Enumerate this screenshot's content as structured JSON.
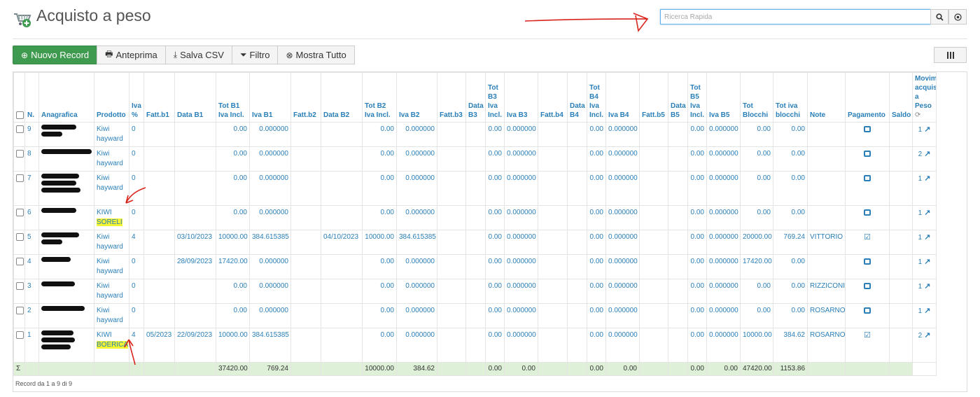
{
  "header": {
    "title": "Acquisto a peso",
    "search_placeholder": "Ricerca Rapida",
    "search_icon": "magnifier-icon",
    "clear_icon": "clear-circle-icon"
  },
  "toolbar": {
    "new_record": "Nuovo Record",
    "preview": "Anteprima",
    "save_csv": "Salva CSV",
    "filter": "Filtro",
    "show_all": "Mostra Tutto",
    "columns_icon": "columns-icon"
  },
  "columns": {
    "n": "N.",
    "anagrafica": "Anagrafica",
    "prodotto": "Prodotto",
    "iva": "Iva %",
    "fatt_b1": "Fatt.b1",
    "data_b1": "Data B1",
    "tot_b1": "Tot B1 Iva Incl.",
    "iva_b1": "Iva B1",
    "fatt_b2": "Fatt.b2",
    "data_b2": "Data B2",
    "tot_b2": "Tot B2 Iva Incl.",
    "iva_b2": "Iva B2",
    "fatt_b3": "Fatt.b3",
    "data_b3": "Data B3",
    "tot_b3": "Tot B3 Iva Incl.",
    "iva_b3": "Iva B3",
    "fatt_b4": "Fatt.b4",
    "data_b4": "Data B4",
    "tot_b4": "Tot B4 Iva Incl.",
    "iva_b4": "Iva B4",
    "fatt_b5": "Fatt.b5",
    "data_b5": "Data B5",
    "tot_b5": "Tot B5 Iva Incl.",
    "iva_b5": "Iva B5",
    "tot_blocchi": "Tot Blocchi",
    "tot_iva_blocchi": "Tot iva blocchi",
    "note": "Note",
    "pagamento": "Pagamento",
    "saldo": "Saldo",
    "movimenti": "Movimenti acquisto a Peso"
  },
  "rows": [
    {
      "n": "9",
      "prod1": "Kiwi",
      "prod2": "hayward",
      "iva": "0",
      "fatt_b1": "",
      "data_b1": "",
      "tot_b1": "0.00",
      "iva_b1": "0.000000",
      "fatt_b2": "",
      "data_b2": "",
      "tot_b2": "0.00",
      "iva_b2": "0.000000",
      "tot_b3": "0.00",
      "iva_b3": "0.000000",
      "tot_b4": "0.00",
      "iva_b4": "0.000000",
      "tot_b5": "0.00",
      "iva_b5": "0.000000",
      "tot_blocchi": "0.00",
      "tot_iva_blocchi": "0.00",
      "note": "",
      "paid": false,
      "mov": "1"
    },
    {
      "n": "8",
      "prod1": "Kiwi",
      "prod2": "hayward",
      "iva": "0",
      "fatt_b1": "",
      "data_b1": "",
      "tot_b1": "0.00",
      "iva_b1": "0.000000",
      "fatt_b2": "",
      "data_b2": "",
      "tot_b2": "0.00",
      "iva_b2": "0.000000",
      "tot_b3": "0.00",
      "iva_b3": "0.000000",
      "tot_b4": "0.00",
      "iva_b4": "0.000000",
      "tot_b5": "0.00",
      "iva_b5": "0.000000",
      "tot_blocchi": "0.00",
      "tot_iva_blocchi": "0.00",
      "note": "",
      "paid": false,
      "mov": "2"
    },
    {
      "n": "7",
      "prod1": "Kiwi",
      "prod2": "hayward",
      "iva": "0",
      "fatt_b1": "",
      "data_b1": "",
      "tot_b1": "0.00",
      "iva_b1": "0.000000",
      "fatt_b2": "",
      "data_b2": "",
      "tot_b2": "0.00",
      "iva_b2": "0.000000",
      "tot_b3": "0.00",
      "iva_b3": "0.000000",
      "tot_b4": "0.00",
      "iva_b4": "0.000000",
      "tot_b5": "0.00",
      "iva_b5": "0.000000",
      "tot_blocchi": "0.00",
      "tot_iva_blocchi": "0.00",
      "note": "",
      "paid": false,
      "mov": "1"
    },
    {
      "n": "6",
      "prod1": "KIWI",
      "prod2": "SORELI",
      "iva": "0",
      "fatt_b1": "",
      "data_b1": "",
      "tot_b1": "0.00",
      "iva_b1": "0.000000",
      "fatt_b2": "",
      "data_b2": "",
      "tot_b2": "0.00",
      "iva_b2": "0.000000",
      "tot_b3": "0.00",
      "iva_b3": "0.000000",
      "tot_b4": "0.00",
      "iva_b4": "0.000000",
      "tot_b5": "0.00",
      "iva_b5": "0.000000",
      "tot_blocchi": "0.00",
      "tot_iva_blocchi": "0.00",
      "note": "",
      "paid": false,
      "mov": "1"
    },
    {
      "n": "5",
      "prod1": "Kiwi",
      "prod2": "hayward",
      "iva": "4",
      "fatt_b1": "",
      "data_b1": "03/10/2023",
      "tot_b1": "10000.00",
      "iva_b1": "384.615385",
      "fatt_b2": "",
      "data_b2": "04/10/2023",
      "tot_b2": "10000.00",
      "iva_b2": "384.615385",
      "tot_b3": "0.00",
      "iva_b3": "0.000000",
      "tot_b4": "0.00",
      "iva_b4": "0.000000",
      "tot_b5": "0.00",
      "iva_b5": "0.000000",
      "tot_blocchi": "20000.00",
      "tot_iva_blocchi": "769.24",
      "note": "VITTORIO",
      "paid": true,
      "mov": "1"
    },
    {
      "n": "4",
      "prod1": "Kiwi",
      "prod2": "hayward",
      "iva": "0",
      "fatt_b1": "",
      "data_b1": "28/09/2023",
      "tot_b1": "17420.00",
      "iva_b1": "0.000000",
      "fatt_b2": "",
      "data_b2": "",
      "tot_b2": "0.00",
      "iva_b2": "0.000000",
      "tot_b3": "0.00",
      "iva_b3": "0.000000",
      "tot_b4": "0.00",
      "iva_b4": "0.000000",
      "tot_b5": "0.00",
      "iva_b5": "0.000000",
      "tot_blocchi": "17420.00",
      "tot_iva_blocchi": "0.00",
      "note": "",
      "paid": false,
      "mov": "1"
    },
    {
      "n": "3",
      "prod1": "Kiwi",
      "prod2": "hayward",
      "iva": "0",
      "fatt_b1": "",
      "data_b1": "",
      "tot_b1": "0.00",
      "iva_b1": "0.000000",
      "fatt_b2": "",
      "data_b2": "",
      "tot_b2": "0.00",
      "iva_b2": "0.000000",
      "tot_b3": "0.00",
      "iva_b3": "0.000000",
      "tot_b4": "0.00",
      "iva_b4": "0.000000",
      "tot_b5": "0.00",
      "iva_b5": "0.000000",
      "tot_blocchi": "0.00",
      "tot_iva_blocchi": "0.00",
      "note": "RIZZICONI",
      "paid": false,
      "mov": "1"
    },
    {
      "n": "2",
      "prod1": "Kiwi",
      "prod2": "hayward",
      "iva": "0",
      "fatt_b1": "",
      "data_b1": "",
      "tot_b1": "0.00",
      "iva_b1": "0.000000",
      "fatt_b2": "",
      "data_b2": "",
      "tot_b2": "0.00",
      "iva_b2": "0.000000",
      "tot_b3": "0.00",
      "iva_b3": "0.000000",
      "tot_b4": "0.00",
      "iva_b4": "0.000000",
      "tot_b5": "0.00",
      "iva_b5": "0.000000",
      "tot_blocchi": "0.00",
      "tot_iva_blocchi": "0.00",
      "note": "ROSARNO",
      "paid": false,
      "mov": "1"
    },
    {
      "n": "1",
      "prod1": "KIWI",
      "prod2": "BOERICA",
      "iva": "4",
      "fatt_b1": "05/2023",
      "data_b1": "22/09/2023",
      "tot_b1": "10000.00",
      "iva_b1": "384.615385",
      "fatt_b2": "",
      "data_b2": "",
      "tot_b2": "0.00",
      "iva_b2": "0.000000",
      "tot_b3": "0.00",
      "iva_b3": "0.000000",
      "tot_b4": "0.00",
      "iva_b4": "0.000000",
      "tot_b5": "0.00",
      "iva_b5": "0.000000",
      "tot_blocchi": "10000.00",
      "tot_iva_blocchi": "384.62",
      "note": "ROSARNO",
      "paid": true,
      "mov": "2"
    }
  ],
  "totals": {
    "sigma": "Σ",
    "tot_b1": "37420.00",
    "iva_b1": "769.24",
    "tot_b2": "10000.00",
    "iva_b2": "384.62",
    "tot_b3": "0.00",
    "iva_b3": "0.00",
    "tot_b4": "0.00",
    "iva_b4": "0.00",
    "tot_b5": "0.00",
    "iva_b5": "0.00",
    "tot_blocchi": "47420.00",
    "tot_iva_blocchi": "1153.86"
  },
  "footer": {
    "records": "Record da 1 a 9 di 9"
  },
  "colors": {
    "accent": "#2a7fb8",
    "primary_button": "#3e9a4e",
    "sum_row": "#dff0d8",
    "highlight": "#f5f534",
    "annotation": "#d9241c"
  }
}
